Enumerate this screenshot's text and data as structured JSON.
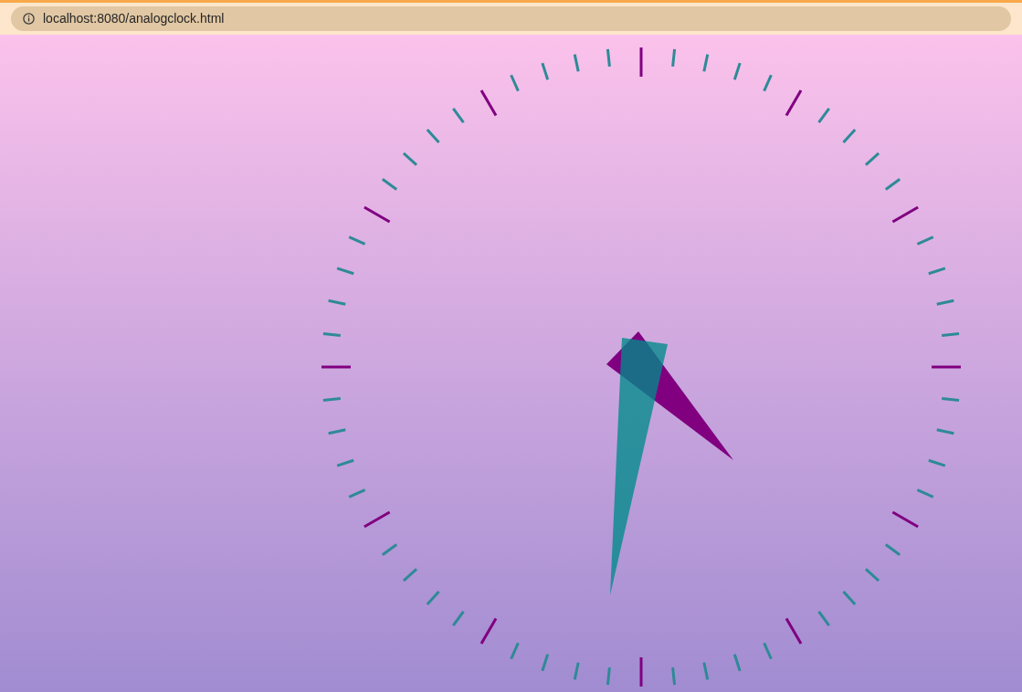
{
  "browser": {
    "address": "localhost:8080/analogclock.html"
  }
}
